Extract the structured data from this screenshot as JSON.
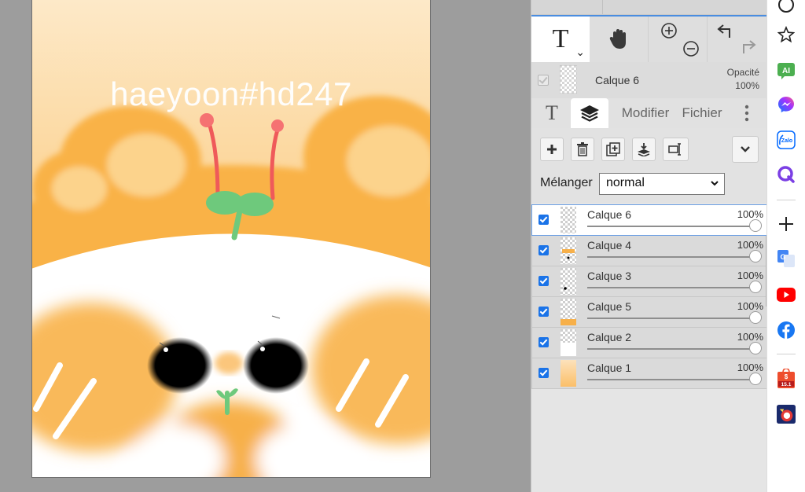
{
  "canvas": {
    "watermark": "haeyoon#hd247"
  },
  "panel": {
    "tools": {
      "text": "T",
      "text_dropdown_icon": "chevron-down-icon",
      "hand_icon": "hand-icon",
      "zoom_in_icon": "zoom-in-icon",
      "zoom_out_icon": "zoom-out-icon",
      "undo_icon": "undo-icon",
      "redo_icon": "redo-icon"
    },
    "current_layer": {
      "name": "Calque 6",
      "opacity_label": "Opacité",
      "opacity_value": "100%"
    },
    "tabs": {
      "text": "T",
      "layers_icon": "layers-icon",
      "modifier": "Modifier",
      "fichier": "Fichier",
      "more_icon": "more-vertical-icon"
    },
    "layer_tools": [
      "add-icon",
      "delete-icon",
      "duplicate-icon",
      "merge-down-icon",
      "rename-icon",
      "chevron-down-icon"
    ],
    "blend": {
      "label": "Mélanger",
      "value": "normal"
    },
    "layers": [
      {
        "name": "Calque 6",
        "opacity": "100%",
        "opacity_fraction": 1.0,
        "visible": true,
        "active": true
      },
      {
        "name": "Calque 4",
        "opacity": "100%",
        "opacity_fraction": 1.0,
        "visible": true,
        "active": false
      },
      {
        "name": "Calque 3",
        "opacity": "100%",
        "opacity_fraction": 1.0,
        "visible": true,
        "active": false
      },
      {
        "name": "Calque 5",
        "opacity": "100%",
        "opacity_fraction": 1.0,
        "visible": true,
        "active": false
      },
      {
        "name": "Calque 2",
        "opacity": "100%",
        "opacity_fraction": 1.0,
        "visible": true,
        "active": false
      },
      {
        "name": "Calque 1",
        "opacity": "100%",
        "opacity_fraction": 1.0,
        "visible": true,
        "active": false
      }
    ]
  },
  "extensions": [
    {
      "name": "circle-extension-icon"
    },
    {
      "name": "star-bookmark-icon"
    },
    {
      "name": "ai-extension-icon",
      "label": "AI"
    },
    {
      "name": "messenger-icon"
    },
    {
      "name": "zalo-icon",
      "label": "Zalo"
    },
    {
      "name": "q-extension-icon"
    },
    {
      "name": "plus-icon"
    },
    {
      "name": "google-translate-icon",
      "label": "G"
    },
    {
      "name": "youtube-icon"
    },
    {
      "name": "facebook-icon"
    },
    {
      "name": "shopee-icon",
      "label": "15.1"
    },
    {
      "name": "game-extension-icon"
    }
  ],
  "colors": {
    "accent": "#1a73e8",
    "panel_bg": "#e5e5e5",
    "canvas_bg": "#9d9d9d",
    "art_orange": "#f8b54b"
  }
}
